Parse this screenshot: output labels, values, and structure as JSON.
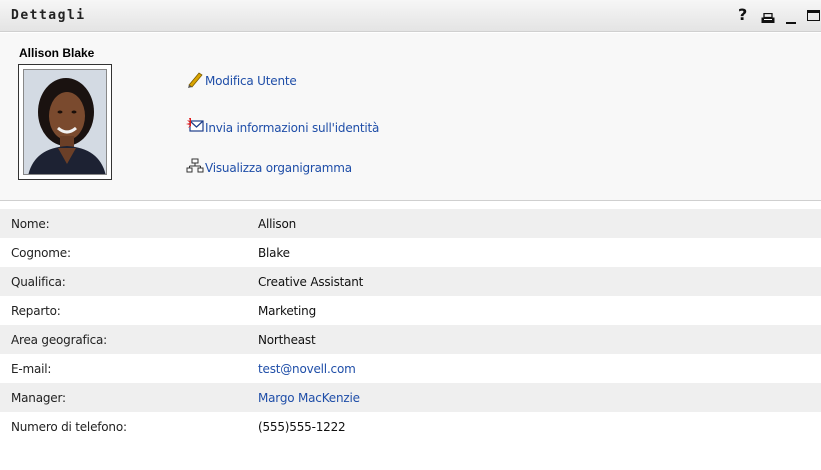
{
  "portlet": {
    "title": "Dettagli",
    "help_glyph": "?",
    "icons": [
      "help-icon",
      "print-icon",
      "minimize-icon",
      "maximize-icon"
    ]
  },
  "user": {
    "name": "Allison Blake",
    "photo_icon": "user-photo"
  },
  "actions": [
    {
      "label": "Modifica Utente",
      "icon": "pencil-icon"
    },
    {
      "label": "Invia informazioni sull'identità",
      "icon": "envelope-icon"
    },
    {
      "label": "Visualizza organigramma",
      "icon": "org-chart-icon"
    }
  ],
  "details": [
    {
      "key": "Nome:",
      "value": "Allison",
      "link": false
    },
    {
      "key": "Cognome:",
      "value": "Blake",
      "link": false
    },
    {
      "key": "Qualifica:",
      "value": "Creative Assistant",
      "link": false
    },
    {
      "key": "Reparto:",
      "value": "Marketing",
      "link": false
    },
    {
      "key": "Area geografica:",
      "value": "Northeast",
      "link": false
    },
    {
      "key": "E-mail:",
      "value": "test@novell.com",
      "link": true
    },
    {
      "key": "Manager:",
      "value": "Margo MacKenzie",
      "link": true
    },
    {
      "key": "Numero di telefono:",
      "value": "(555)555-1222",
      "link": false
    }
  ],
  "colors": {
    "link": "#1f4ea8",
    "row_shade": "#efefef",
    "header_bg": "#f8f8f8"
  }
}
